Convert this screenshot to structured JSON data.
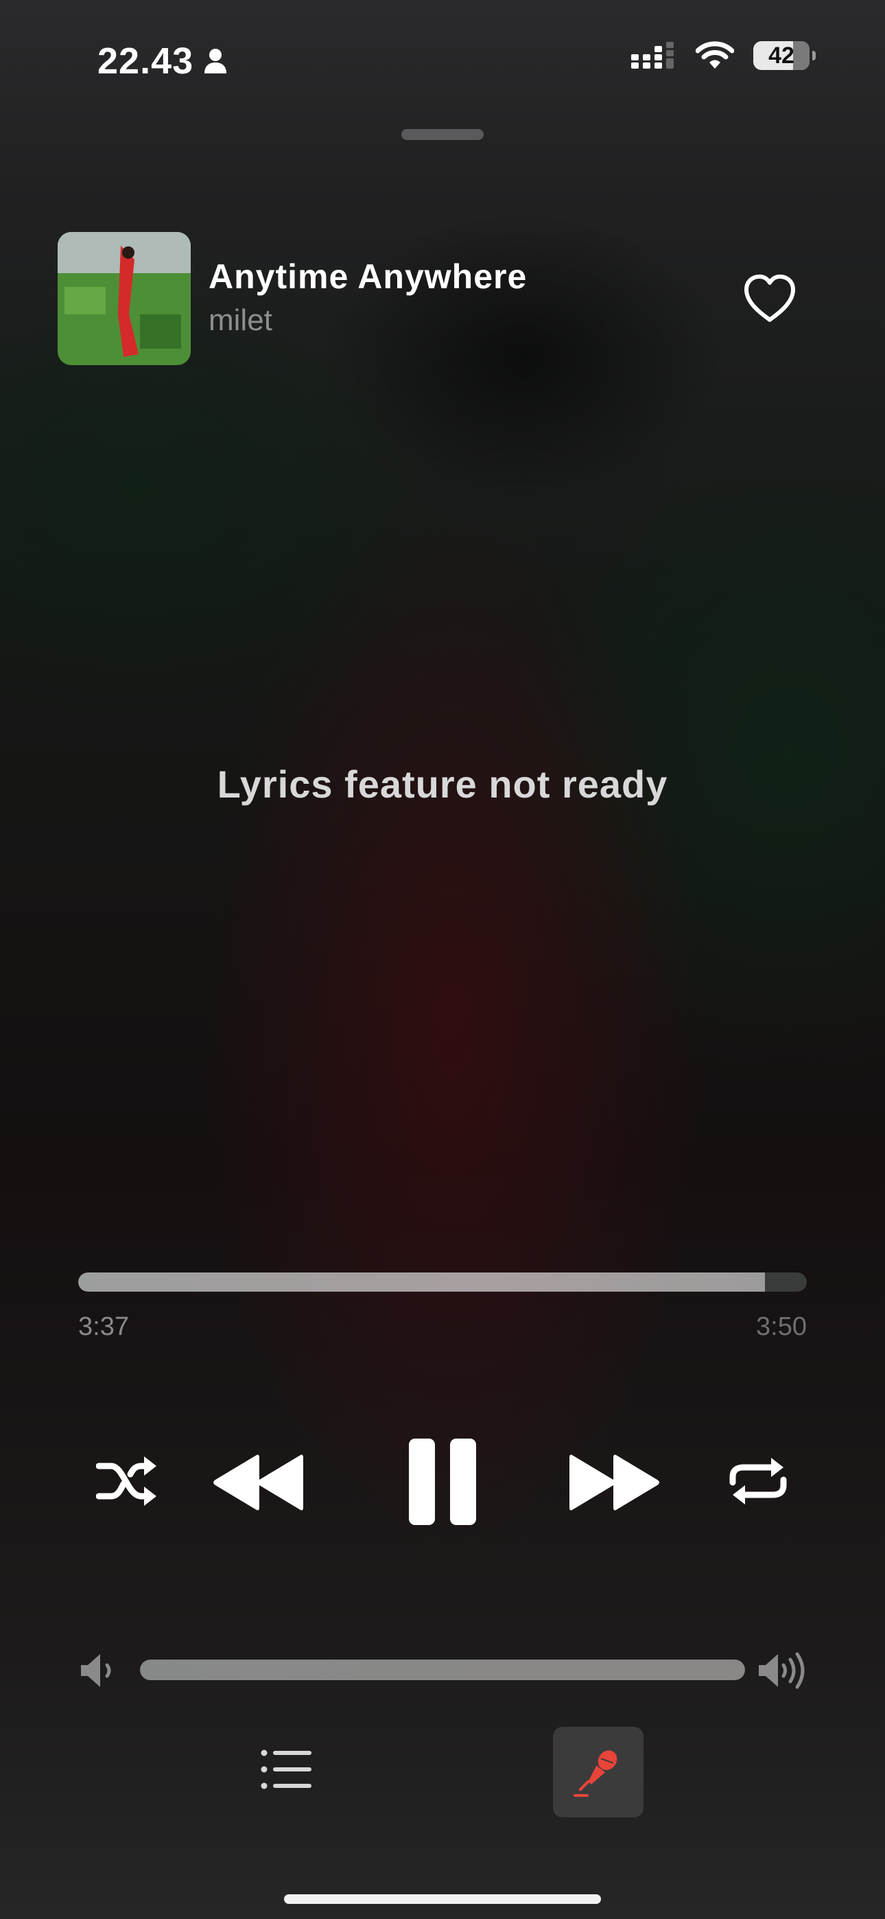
{
  "status_bar": {
    "time": "22.43",
    "battery_level": "42",
    "icons": [
      "person-icon",
      "cellular-signal-icon",
      "wifi-icon",
      "battery-icon"
    ]
  },
  "now_playing": {
    "title": "Anytime Anywhere",
    "artist": "milet",
    "liked": false
  },
  "lyrics": {
    "message": "Lyrics feature not ready"
  },
  "progress": {
    "elapsed": "3:37",
    "total": "3:50",
    "fraction": 0.943
  },
  "controls": {
    "icons": [
      "shuffle-icon",
      "rewind-icon",
      "pause-icon",
      "fast-forward-icon",
      "repeat-icon"
    ]
  },
  "volume": {
    "level": 1.0
  },
  "bottom_bar": {
    "icons": [
      "queue-list-icon",
      "microphone-icon"
    ],
    "lyrics_active": true
  },
  "colors": {
    "accent": "#e8443a",
    "text_primary": "#ffffff",
    "text_secondary": "#8e8e90"
  }
}
